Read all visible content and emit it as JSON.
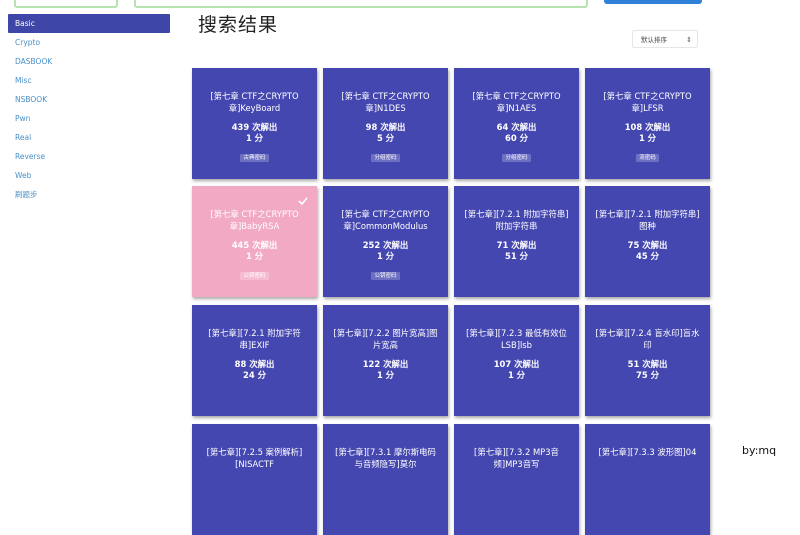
{
  "sidebar": {
    "items": [
      {
        "label": "Basic",
        "active": true
      },
      {
        "label": "Crypto"
      },
      {
        "label": "DASBOOK"
      },
      {
        "label": "Misc"
      },
      {
        "label": "NSBOOK"
      },
      {
        "label": "Pwn"
      },
      {
        "label": "Real"
      },
      {
        "label": "Reverse"
      },
      {
        "label": "Web"
      },
      {
        "label": "刷题步"
      }
    ]
  },
  "header": {
    "title": "搜索结果",
    "sort_label": "默认排序"
  },
  "challenges": [
    {
      "name": "[第七章 CTF之CRYPTO章]KeyBoard",
      "solves": "439 次解出",
      "score": "1 分",
      "tag": "古典密码"
    },
    {
      "name": "[第七章 CTF之CRYPTO章]N1DES",
      "solves": "98 次解出",
      "score": "5 分",
      "tag": "分组密码"
    },
    {
      "name": "[第七章 CTF之CRYPTO章]N1AES",
      "solves": "64 次解出",
      "score": "60 分",
      "tag": "分组密码"
    },
    {
      "name": "[第七章 CTF之CRYPTO章]LFSR",
      "solves": "108 次解出",
      "score": "1 分",
      "tag": "流密码"
    },
    {
      "name": "[第七章 CTF之CRYPTO章]BabyRSA",
      "solves": "445 次解出",
      "score": "1 分",
      "tag": "公钥密码",
      "solved": true
    },
    {
      "name": "[第七章 CTF之CRYPTO章]CommonModulus",
      "solves": "252 次解出",
      "score": "1 分",
      "tag": "公钥密码"
    },
    {
      "name": "[第七章][7.2.1 附加字符串]附加字符串",
      "solves": "71 次解出",
      "score": "51 分"
    },
    {
      "name": "[第七章][7.2.1 附加字符串]图种",
      "solves": "75 次解出",
      "score": "45 分"
    },
    {
      "name": "[第七章][7.2.1 附加字符串]EXIF",
      "solves": "88 次解出",
      "score": "24 分"
    },
    {
      "name": "[第七章][7.2.2 图片宽高]图片宽高",
      "solves": "122 次解出",
      "score": "1 分"
    },
    {
      "name": "[第七章][7.2.3 最低有效位LSB]lsb",
      "solves": "107 次解出",
      "score": "1 分"
    },
    {
      "name": "[第七章][7.2.4 盲水印]盲水印",
      "solves": "51 次解出",
      "score": "75 分"
    },
    {
      "name": "[第七章][7.2.5 案例解析][NISACTF",
      "solves": "",
      "score": ""
    },
    {
      "name": "[第七章][7.3.1 摩尔斯电码与音频隐写]莫尔",
      "solves": "",
      "score": ""
    },
    {
      "name": "[第七章][7.3.2 MP3音频]MP3音写",
      "solves": "",
      "score": ""
    },
    {
      "name": "[第七章][7.3.3 波形图]04",
      "solves": "",
      "score": ""
    }
  ],
  "footer": {
    "by": "by:mq"
  },
  "colors": {
    "card": "#4547b0",
    "solved_card": "#f2a9c4",
    "sidebar_active": "#3e46a8",
    "link": "#4a90c8"
  },
  "icons": {
    "solved": "check-icon",
    "sort": "sort-caret-icon"
  }
}
